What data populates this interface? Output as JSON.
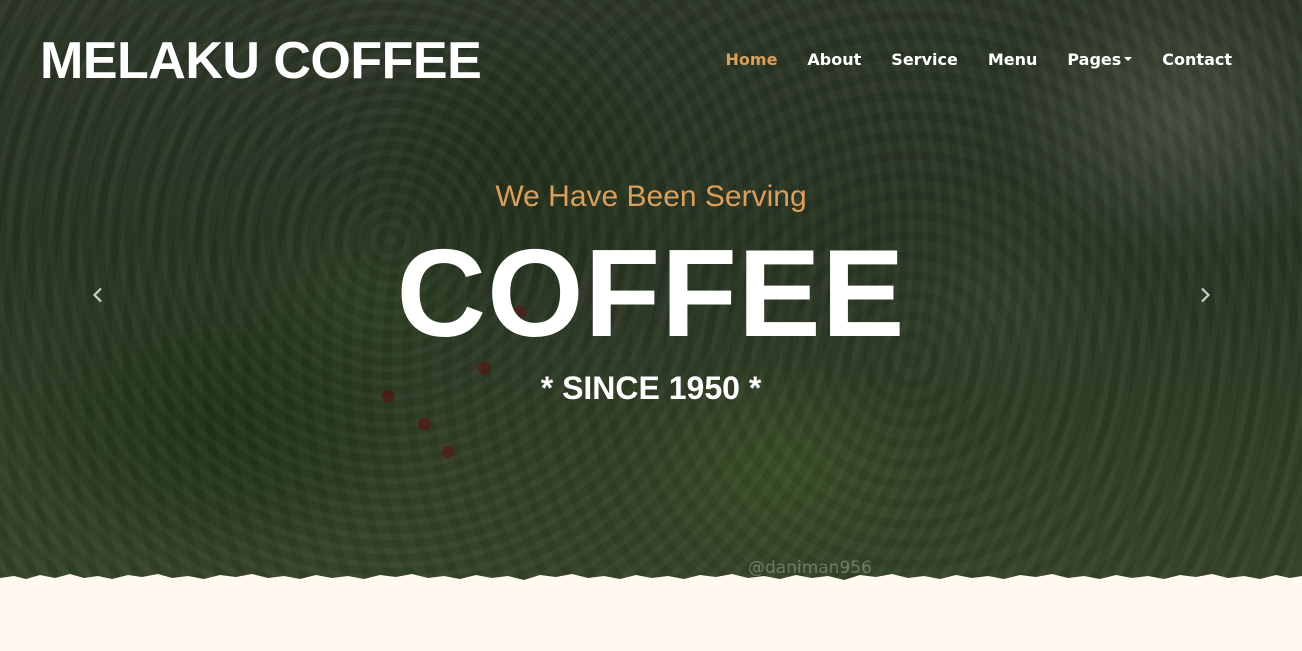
{
  "brand": {
    "name": "MELAKU COFFEE"
  },
  "nav": {
    "items": [
      {
        "label": "Home",
        "active": true
      },
      {
        "label": "About",
        "active": false
      },
      {
        "label": "Service",
        "active": false
      },
      {
        "label": "Menu",
        "active": false
      },
      {
        "label": "Pages",
        "active": false,
        "dropdown": true
      },
      {
        "label": "Contact",
        "active": false
      }
    ]
  },
  "carousel": {
    "subtitle": "We Have Been Serving",
    "headline": "COFFEE",
    "tagline": "* SINCE 1950 *",
    "prev_icon": "chevron-left-icon",
    "next_icon": "chevron-right-icon"
  },
  "watermark": {
    "text": "@daniman956"
  },
  "colors": {
    "accent": "#DA9F5B",
    "text": "#FFFFFF",
    "page_background": "#FFF9F0"
  }
}
